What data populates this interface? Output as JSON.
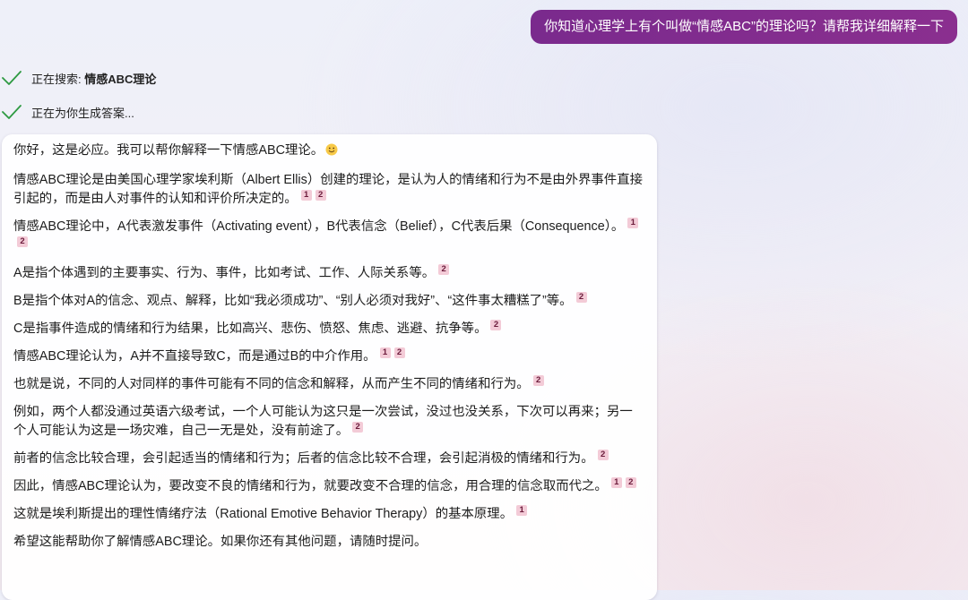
{
  "user_message": "你知道心理学上有个叫做“情感ABC”的理论吗？请帮我详细解释一下",
  "status": [
    {
      "prefix": "正在搜索: ",
      "query": "情感ABC理论"
    },
    {
      "prefix": "正在为你生成答案...",
      "query": ""
    }
  ],
  "answer": {
    "p0": "你好，这是必应。我可以帮你解释一下情感ABC理论。",
    "p1": "情感ABC理论是由美国心理学家埃利斯（Albert Ellis）创建的理论，是认为人的情绪和行为不是由外界事件直接引起的，而是由人对事件的认知和评价所决定的。",
    "p2": "情感ABC理论中，A代表激发事件（Activating event），B代表信念（Belief），C代表后果（Consequence）。",
    "p3": "A是指个体遇到的主要事实、行为、事件，比如考试、工作、人际关系等。",
    "p4": "B是指个体对A的信念、观点、解释，比如“我必须成功”、“别人必须对我好”、“这件事太糟糕了”等。",
    "p5": "C是指事件造成的情绪和行为结果，比如高兴、悲伤、愤怒、焦虑、逃避、抗争等。",
    "p6": "情感ABC理论认为，A并不直接导致C，而是通过B的中介作用。",
    "p7": "也就是说，不同的人对同样的事件可能有不同的信念和解释，从而产生不同的情绪和行为。",
    "p8": "例如，两个人都没通过英语六级考试，一个人可能认为这只是一次尝试，没过也没关系，下次可以再来；另一个人可能认为这是一场灾难，自己一无是处，没有前途了。",
    "p9": "前者的信念比较合理，会引起适当的情绪和行为；后者的信念比较不合理，会引起消极的情绪和行为。",
    "p10": "因此，情感ABC理论认为，要改变不良的情绪和行为，就要改变不合理的信念，用合理的信念取而代之。",
    "p11": "这就是埃利斯提出的理性情绪疗法（Rational Emotive Behavior Therapy）的基本原理。",
    "p12": "希望这能帮助你了解情感ABC理论。如果你还有其他问题，请随时提问。"
  },
  "citations": {
    "c1": "1",
    "c2": "2"
  },
  "icons": {
    "status": "checkmark-icon",
    "emoji": "smiley-emoji-icon"
  },
  "colors": {
    "user_bubble": "#7a2a8d",
    "check": "#2e9a42",
    "citation_bg": "#f3cbd7"
  }
}
